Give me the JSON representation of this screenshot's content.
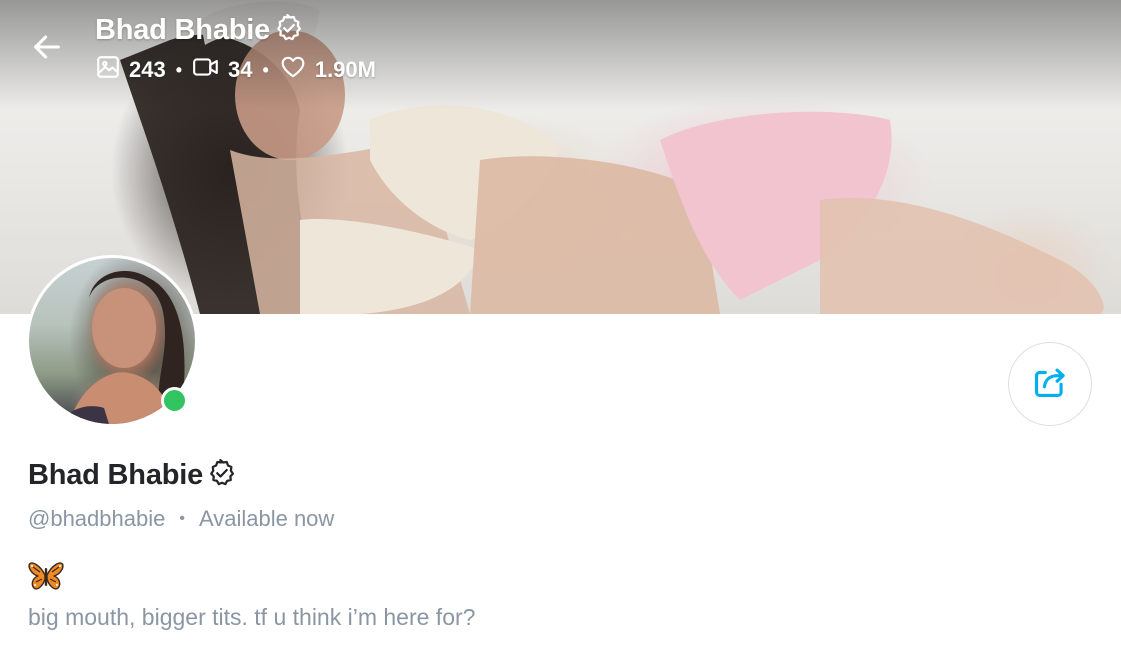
{
  "header": {
    "name": "Bhad Bhabie",
    "stats": {
      "photos": "243",
      "videos": "34",
      "likes": "1.90M"
    },
    "separator": "•"
  },
  "profile": {
    "name": "Bhad Bhabie",
    "username": "@bhadbhabie",
    "meta_separator": "•",
    "status": "Available now",
    "bio_emoji": "butterfly-emoji",
    "bio_text": "big mouth, bigger tits. tf u think i’m here for?"
  },
  "colors": {
    "accent": "#00aff0",
    "online": "#33c462",
    "muted_text": "#8a96a3",
    "primary_text": "#242529"
  },
  "icons": {
    "back": "arrow-left-icon",
    "verified": "verified-badge-icon",
    "photos": "image-icon",
    "videos": "video-icon",
    "likes": "heart-icon",
    "share": "share-icon"
  }
}
